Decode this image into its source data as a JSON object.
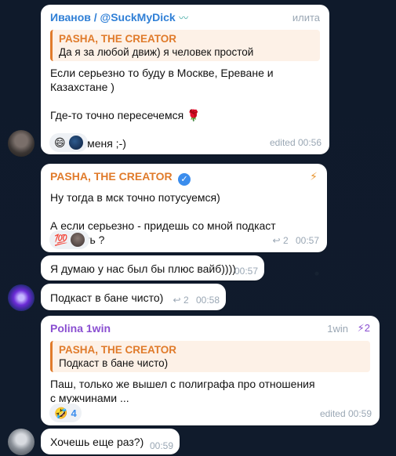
{
  "messages": [
    {
      "sender": "Иванов / @SuckMyDick",
      "role": "илита",
      "reply_to": {
        "name": "PASHA, THE CREATOR",
        "text": "Да я за любой движ) я человек простой"
      },
      "lines": [
        "Если серьезно то буду в Москве, Ереване и Казахстане )",
        "Где-то точно пересечемся 🌹",
        "Баня с меня ;-)"
      ],
      "reactions": [
        "😄"
      ],
      "meta": "edited 00:56"
    },
    {
      "sender": "PASHA, THE CREATOR",
      "verified": "✓",
      "badge": "⚡",
      "lines": [
        "Ну тогда в мск точно потусуемся)",
        "А если серьезно - придешь со мной подкаст записать ?"
      ],
      "reactions": [
        "💯"
      ],
      "replies": "2",
      "meta": "00:57"
    },
    {
      "text": "Я думаю у нас был бы плюс вайб))))",
      "meta": "00:57"
    },
    {
      "text": "Подкаст в бане чисто)",
      "replies": "2",
      "meta": "00:58"
    },
    {
      "sender": "Polina 1win",
      "role": "1win",
      "boost": "2",
      "reply_to": {
        "name": "PASHA, THE CREATOR",
        "text": "Подкаст в бане чисто)"
      },
      "lines": [
        "Паш, только же вышел с полиграфа про отношения с мужчинами ..."
      ],
      "reaction": {
        "emoji": "🤣",
        "count": "4"
      },
      "meta": "edited 00:59"
    },
    {
      "text": "Хочешь еще раз?)",
      "meta": "00:59"
    }
  ],
  "colors": {
    "background": "#0f1a2b",
    "ivanov_name": "#2f7fd6",
    "pasha_name": "#e07b2b",
    "polina_name": "#8a4fd1",
    "meta": "#9aa7b4"
  }
}
